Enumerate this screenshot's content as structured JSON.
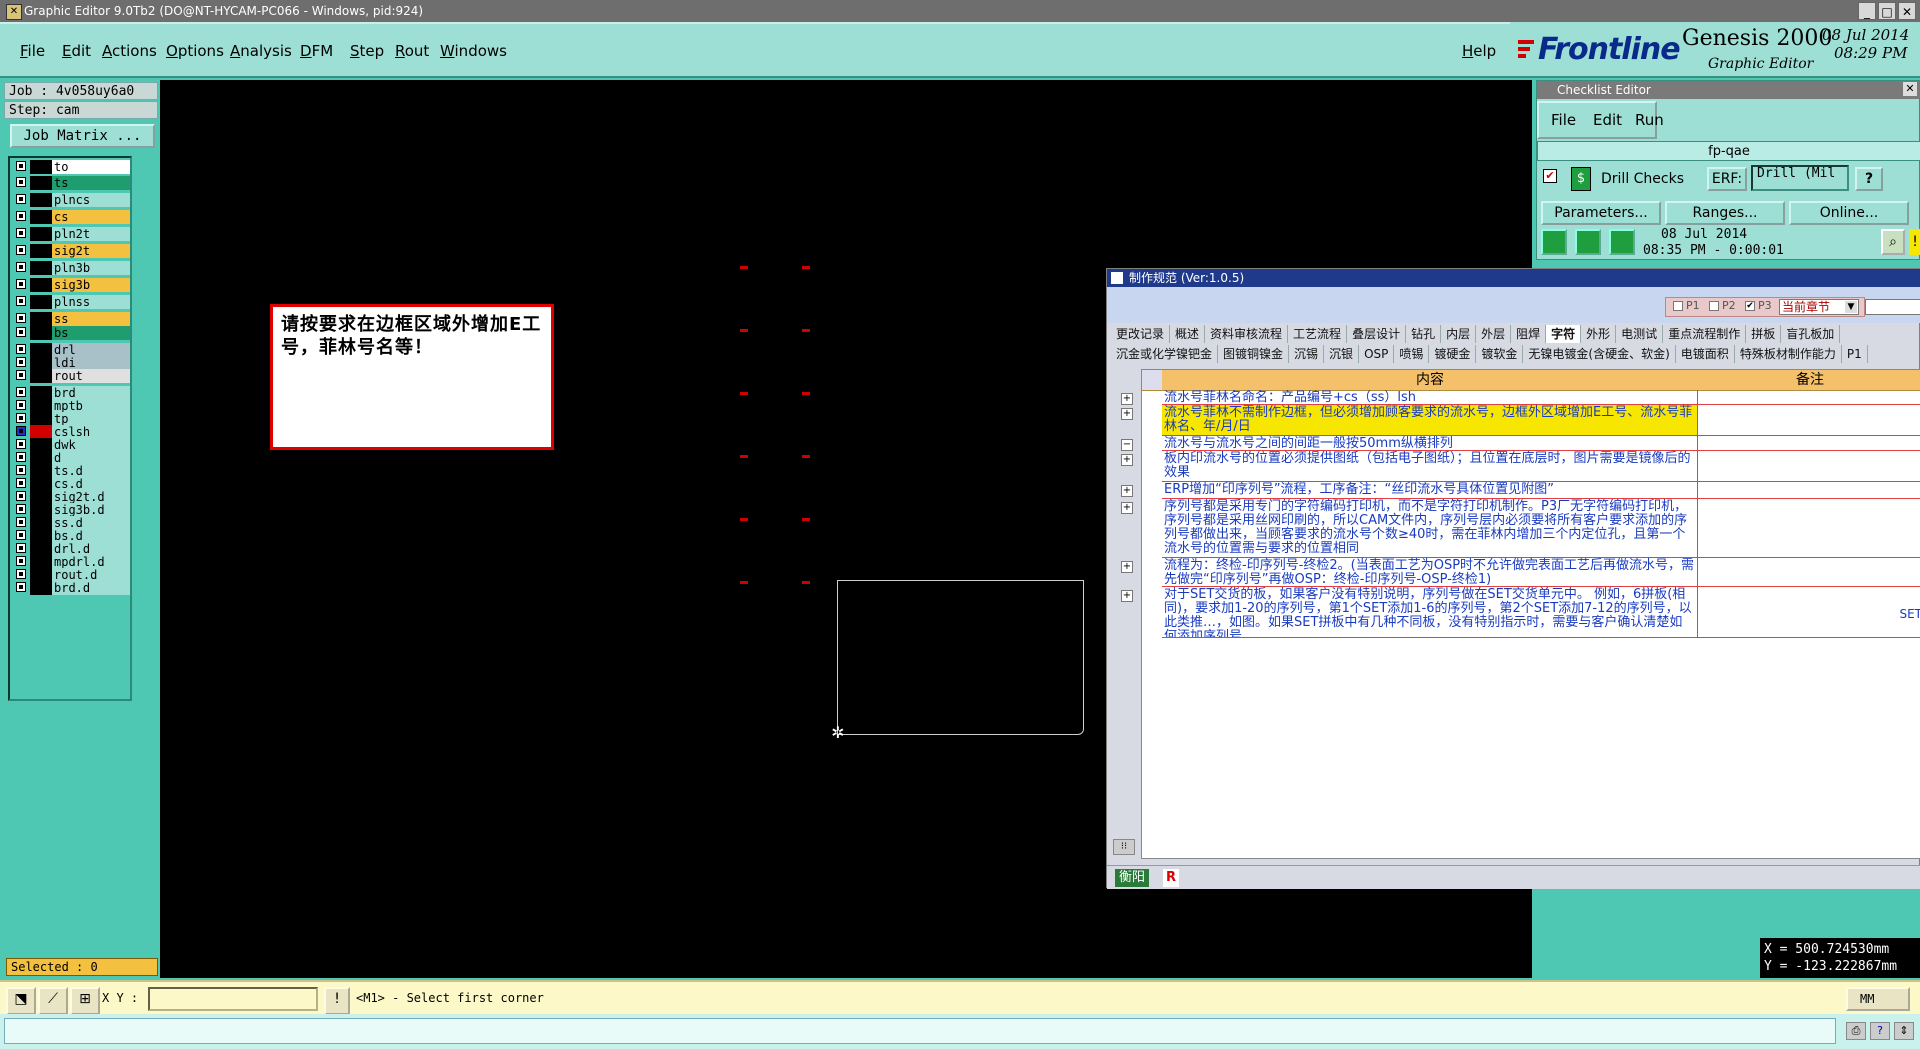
{
  "window": {
    "title": "Graphic Editor 9.0Tb2 (DO@NT-HYCAM-PC066 - Windows, pid:924)",
    "controls": [
      "_",
      "□",
      "✕"
    ]
  },
  "menu": {
    "items": [
      "File",
      "Edit",
      "Actions",
      "Options",
      "Analysis",
      "DFM",
      "Step",
      "Rout",
      "Windows"
    ],
    "help": "Help"
  },
  "brand": {
    "logo": "Frontline",
    "product": "Genesis 2000",
    "subtitle": "Graphic Editor",
    "date": "08 Jul 2014",
    "time": "08:29 PM"
  },
  "job": {
    "job_label": "Job : 4v058uy6a0",
    "step_label": "Step: cam",
    "matrix_button": "Job Matrix ..."
  },
  "layers": [
    {
      "name": "to",
      "color": "#ffffff"
    },
    {
      "name": "ts",
      "color": "#1e9e6e"
    },
    {
      "name": "plncs",
      "color": "#9ddfd5"
    },
    {
      "name": "cs",
      "color": "#f3c040"
    },
    {
      "name": "pln2t",
      "color": "#9ddfd5"
    },
    {
      "name": "sig2t",
      "color": "#f3c040"
    },
    {
      "name": "pln3b",
      "color": "#9ddfd5"
    },
    {
      "name": "sig3b",
      "color": "#f3c040"
    },
    {
      "name": "plnss",
      "color": "#9ddfd5"
    },
    {
      "name": "ss",
      "color": "#f3c040"
    },
    {
      "name": "bs",
      "color": "#1e9e6e"
    },
    {
      "name": "drl",
      "color": "#a8c0c8"
    },
    {
      "name": "ldi",
      "color": "#a8c0c8"
    },
    {
      "name": "rout",
      "color": "#e0e0e0"
    },
    {
      "name": "brd",
      "color": "#9ddfd5"
    },
    {
      "name": "mptb",
      "color": "#9ddfd5"
    },
    {
      "name": "tp",
      "color": "#9ddfd5"
    },
    {
      "name": "cslsh",
      "color": "#9ddfd5"
    },
    {
      "name": "dwk",
      "color": "#9ddfd5"
    },
    {
      "name": "d",
      "color": "#9ddfd5"
    },
    {
      "name": "ts.d",
      "color": "#9ddfd5"
    },
    {
      "name": "cs.d",
      "color": "#9ddfd5"
    },
    {
      "name": "sig2t.d",
      "color": "#9ddfd5"
    },
    {
      "name": "sig3b.d",
      "color": "#9ddfd5"
    },
    {
      "name": "ss.d",
      "color": "#9ddfd5"
    },
    {
      "name": "bs.d",
      "color": "#9ddfd5"
    },
    {
      "name": "drl.d",
      "color": "#9ddfd5"
    },
    {
      "name": "mpdrl.d",
      "color": "#9ddfd5"
    },
    {
      "name": "rout.d",
      "color": "#9ddfd5"
    },
    {
      "name": "brd.d",
      "color": "#9ddfd5"
    }
  ],
  "canvas": {
    "note_text": "请按要求在边框区域外增加E工号，菲林号名等！"
  },
  "selected": "Selected : 0",
  "coords": {
    "x": "X = 500.724530mm",
    "y": "Y = -123.222867mm"
  },
  "bottombar": {
    "xy_label": "X Y :",
    "prompt": "<M1> - Select first corner",
    "units": "MM"
  },
  "checklist": {
    "title": "Checklist Editor",
    "menu": [
      "File",
      "Edit",
      "Run"
    ],
    "name": "fp-qae",
    "check_name": "Drill Checks",
    "erf_label": "ERF:",
    "erf_value": "Drill (Mil",
    "help_button": "?",
    "parameters": "Parameters...",
    "ranges": "Ranges...",
    "online": "Online...",
    "date": "08 Jul 2014",
    "time": "08:35 PM - 0:00:01"
  },
  "spec": {
    "title": "制作规范 (Ver:1.0.5)",
    "filters": [
      "P1",
      "P2",
      "P3"
    ],
    "scope": "当前章节",
    "tabs_row1": [
      "更改记录",
      "概述",
      "资料审核流程",
      "工艺流程",
      "叠层设计",
      "钻孔",
      "内层",
      "外层",
      "阻焊",
      "字符",
      "外形",
      "电测试",
      "重点流程制作",
      "拼板",
      "盲孔板加"
    ],
    "tabs_row2": [
      "沉金或化学镍钯金",
      "图镀铜镍金",
      "沉锡",
      "沉银",
      "OSP",
      "喷锡",
      "镀硬金",
      "镀软金",
      "无镍电镀金(含硬金、软金)",
      "电镀面积",
      "特殊板材制作能力",
      "P1"
    ],
    "active_tab": "字符",
    "col_content": "内容",
    "col_note": "备注",
    "rows": [
      {
        "text": "流水号菲林名命名：产品编号+cs（ss）lsh",
        "note": ""
      },
      {
        "text": "流水号菲林不需制作边框，但必须增加顾客要求的流水号，边框外区域增加E工号、流水号菲林名、年/月/日",
        "note": ""
      },
      {
        "text": "流水号与流水号之间的间距一般按50mm纵横排列",
        "note": ""
      },
      {
        "text": "板内印流水号的位置必须提供图纸（包括电子图纸）；且位置在底层时，图片需要是镜像后的效果",
        "note": ""
      },
      {
        "text": "ERP增加“印序列号”流程，工序备注：“丝印流水号具体位置见附图”",
        "note": ""
      },
      {
        "text": "序列号都是采用专门的字符编码打印机，而不是字符打印机制作。P3厂无字符编码打印机，序列号都是采用丝网印刷的，所以CAM文件内，序列号层内必须要将所有客户要求添加的序列号都做出来，当顾客要求的流水号个数≥40时，需在菲林内增加三个内定位孔，且第一个流水号的位置需与要求的位置相同",
        "note": ""
      },
      {
        "text": "流程为：终检-印序列号-终检2。(当表面工艺为OSP时不允许做完表面工艺后再做流水号，需先做完“印序列号”再做OSP：终检-印序列号-OSP-终检1)",
        "note": ""
      },
      {
        "text": "对于SET交货的板，如果客户没有特别说明，序列号做在SET交货单元中。 例如，6拼板(相同)，要求加1-20的序列号，第1个SET添加1-6的序列号，第2个SET添加7-12的序列号，以此类推…，如图。如果SET拼板中有几种不同板，没有特别指示时，需要与客户确认清楚如何添加序列号",
        "note": "SET"
      }
    ],
    "status_a": "衡阳",
    "status_b": "R"
  },
  "colors": {
    "app_bg": "#4ec7b3",
    "panel": "#9ddfd5",
    "canvas": "#000000",
    "highlight": "#f6e600",
    "spec_title": "#1f3a8a"
  }
}
